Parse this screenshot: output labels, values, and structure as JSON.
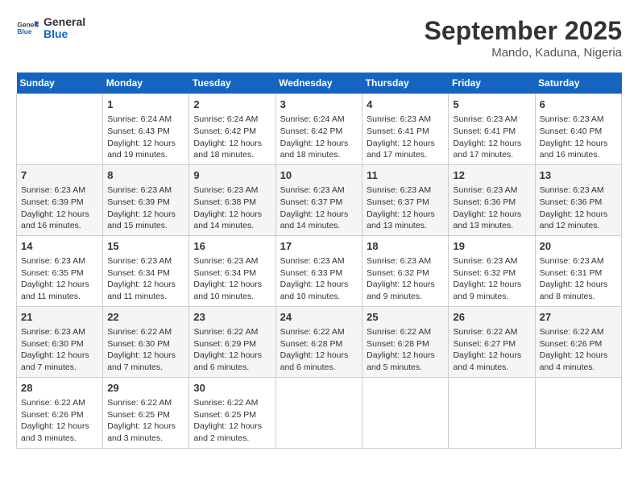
{
  "logo": {
    "general": "General",
    "blue": "Blue"
  },
  "title": "September 2025",
  "location": "Mando, Kaduna, Nigeria",
  "days_of_week": [
    "Sunday",
    "Monday",
    "Tuesday",
    "Wednesday",
    "Thursday",
    "Friday",
    "Saturday"
  ],
  "weeks": [
    [
      {
        "day": "",
        "info": ""
      },
      {
        "day": "1",
        "info": "Sunrise: 6:24 AM\nSunset: 6:43 PM\nDaylight: 12 hours\nand 19 minutes."
      },
      {
        "day": "2",
        "info": "Sunrise: 6:24 AM\nSunset: 6:42 PM\nDaylight: 12 hours\nand 18 minutes."
      },
      {
        "day": "3",
        "info": "Sunrise: 6:24 AM\nSunset: 6:42 PM\nDaylight: 12 hours\nand 18 minutes."
      },
      {
        "day": "4",
        "info": "Sunrise: 6:23 AM\nSunset: 6:41 PM\nDaylight: 12 hours\nand 17 minutes."
      },
      {
        "day": "5",
        "info": "Sunrise: 6:23 AM\nSunset: 6:41 PM\nDaylight: 12 hours\nand 17 minutes."
      },
      {
        "day": "6",
        "info": "Sunrise: 6:23 AM\nSunset: 6:40 PM\nDaylight: 12 hours\nand 16 minutes."
      }
    ],
    [
      {
        "day": "7",
        "info": "Sunrise: 6:23 AM\nSunset: 6:39 PM\nDaylight: 12 hours\nand 16 minutes."
      },
      {
        "day": "8",
        "info": "Sunrise: 6:23 AM\nSunset: 6:39 PM\nDaylight: 12 hours\nand 15 minutes."
      },
      {
        "day": "9",
        "info": "Sunrise: 6:23 AM\nSunset: 6:38 PM\nDaylight: 12 hours\nand 14 minutes."
      },
      {
        "day": "10",
        "info": "Sunrise: 6:23 AM\nSunset: 6:37 PM\nDaylight: 12 hours\nand 14 minutes."
      },
      {
        "day": "11",
        "info": "Sunrise: 6:23 AM\nSunset: 6:37 PM\nDaylight: 12 hours\nand 13 minutes."
      },
      {
        "day": "12",
        "info": "Sunrise: 6:23 AM\nSunset: 6:36 PM\nDaylight: 12 hours\nand 13 minutes."
      },
      {
        "day": "13",
        "info": "Sunrise: 6:23 AM\nSunset: 6:36 PM\nDaylight: 12 hours\nand 12 minutes."
      }
    ],
    [
      {
        "day": "14",
        "info": "Sunrise: 6:23 AM\nSunset: 6:35 PM\nDaylight: 12 hours\nand 11 minutes."
      },
      {
        "day": "15",
        "info": "Sunrise: 6:23 AM\nSunset: 6:34 PM\nDaylight: 12 hours\nand 11 minutes."
      },
      {
        "day": "16",
        "info": "Sunrise: 6:23 AM\nSunset: 6:34 PM\nDaylight: 12 hours\nand 10 minutes."
      },
      {
        "day": "17",
        "info": "Sunrise: 6:23 AM\nSunset: 6:33 PM\nDaylight: 12 hours\nand 10 minutes."
      },
      {
        "day": "18",
        "info": "Sunrise: 6:23 AM\nSunset: 6:32 PM\nDaylight: 12 hours\nand 9 minutes."
      },
      {
        "day": "19",
        "info": "Sunrise: 6:23 AM\nSunset: 6:32 PM\nDaylight: 12 hours\nand 9 minutes."
      },
      {
        "day": "20",
        "info": "Sunrise: 6:23 AM\nSunset: 6:31 PM\nDaylight: 12 hours\nand 8 minutes."
      }
    ],
    [
      {
        "day": "21",
        "info": "Sunrise: 6:23 AM\nSunset: 6:30 PM\nDaylight: 12 hours\nand 7 minutes."
      },
      {
        "day": "22",
        "info": "Sunrise: 6:22 AM\nSunset: 6:30 PM\nDaylight: 12 hours\nand 7 minutes."
      },
      {
        "day": "23",
        "info": "Sunrise: 6:22 AM\nSunset: 6:29 PM\nDaylight: 12 hours\nand 6 minutes."
      },
      {
        "day": "24",
        "info": "Sunrise: 6:22 AM\nSunset: 6:28 PM\nDaylight: 12 hours\nand 6 minutes."
      },
      {
        "day": "25",
        "info": "Sunrise: 6:22 AM\nSunset: 6:28 PM\nDaylight: 12 hours\nand 5 minutes."
      },
      {
        "day": "26",
        "info": "Sunrise: 6:22 AM\nSunset: 6:27 PM\nDaylight: 12 hours\nand 4 minutes."
      },
      {
        "day": "27",
        "info": "Sunrise: 6:22 AM\nSunset: 6:26 PM\nDaylight: 12 hours\nand 4 minutes."
      }
    ],
    [
      {
        "day": "28",
        "info": "Sunrise: 6:22 AM\nSunset: 6:26 PM\nDaylight: 12 hours\nand 3 minutes."
      },
      {
        "day": "29",
        "info": "Sunrise: 6:22 AM\nSunset: 6:25 PM\nDaylight: 12 hours\nand 3 minutes."
      },
      {
        "day": "30",
        "info": "Sunrise: 6:22 AM\nSunset: 6:25 PM\nDaylight: 12 hours\nand 2 minutes."
      },
      {
        "day": "",
        "info": ""
      },
      {
        "day": "",
        "info": ""
      },
      {
        "day": "",
        "info": ""
      },
      {
        "day": "",
        "info": ""
      }
    ]
  ]
}
